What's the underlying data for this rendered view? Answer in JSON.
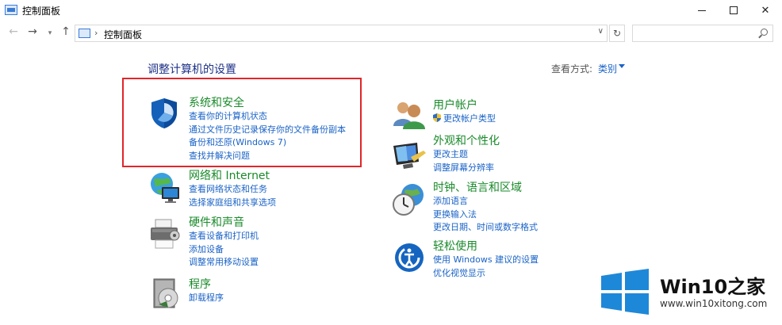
{
  "window": {
    "title": "控制面板"
  },
  "address_bar": {
    "path": "控制面板",
    "separator": "›"
  },
  "header": {
    "title": "调整计算机的设置",
    "view_label": "查看方式:",
    "view_value": "类别"
  },
  "categories": {
    "system_security": {
      "title": "系统和安全",
      "links": [
        "查看你的计算机状态",
        "通过文件历史记录保存你的文件备份副本",
        "备份和还原(Windows 7)",
        "查找并解决问题"
      ]
    },
    "network": {
      "title": "网络和 Internet",
      "links": [
        "查看网络状态和任务",
        "选择家庭组和共享选项"
      ]
    },
    "hardware": {
      "title": "硬件和声音",
      "links": [
        "查看设备和打印机",
        "添加设备",
        "调整常用移动设置"
      ]
    },
    "programs": {
      "title": "程序",
      "links": [
        "卸载程序"
      ]
    },
    "user_accounts": {
      "title": "用户帐户",
      "links": [
        "更改帐户类型"
      ]
    },
    "appearance": {
      "title": "外观和个性化",
      "links": [
        "更改主题",
        "调整屏幕分辨率"
      ]
    },
    "clock_region": {
      "title": "时钟、语言和区域",
      "links": [
        "添加语言",
        "更换输入法",
        "更改日期、时间或数字格式"
      ]
    },
    "ease_access": {
      "title": "轻松使用",
      "links": [
        "使用 Windows 建议的设置",
        "优化视觉显示"
      ]
    }
  },
  "watermark": {
    "brand": "Win10之家",
    "url": "www.win10xitong.com"
  },
  "colors": {
    "category_title": "#1a8a2b",
    "link": "#1a63c7",
    "page_title": "#1e3287",
    "highlight_box": "#e0262b",
    "windows_logo": "#1e88d8"
  }
}
